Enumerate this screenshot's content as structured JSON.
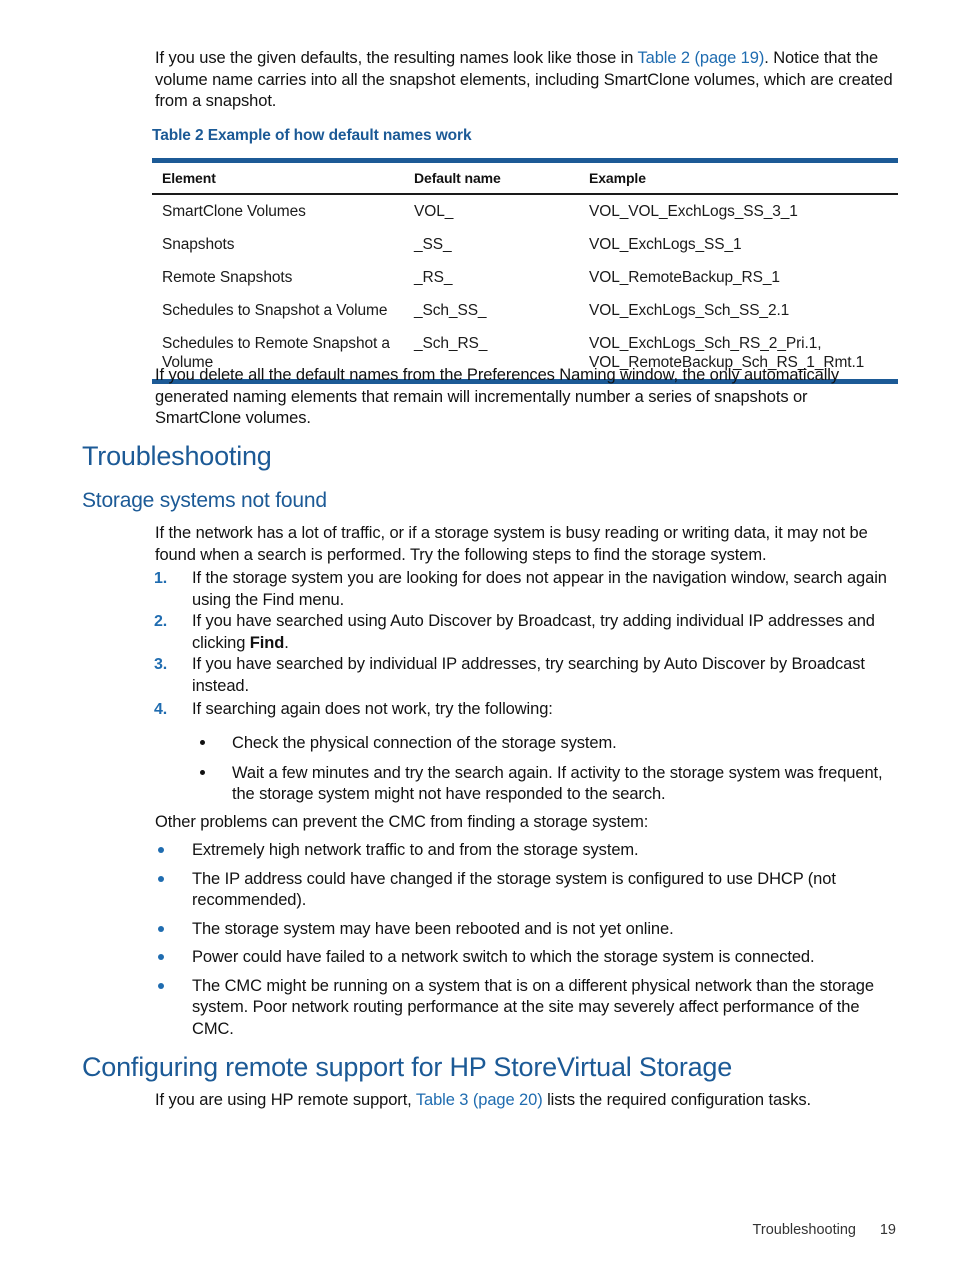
{
  "intro": {
    "text_before_link": "If you use the given defaults, the resulting names look like those in ",
    "link": "Table 2 (page 19)",
    "text_after_link": ". Notice that the volume name carries into all the snapshot elements, including SmartClone volumes, which are created from a snapshot."
  },
  "table": {
    "caption": "Table 2 Example of how default names work",
    "headers": [
      "Element",
      "Default name",
      "Example"
    ],
    "rows": [
      {
        "element": "SmartClone Volumes",
        "default_name": "VOL_",
        "example": "VOL_VOL_ExchLogs_SS_3_1"
      },
      {
        "element": "Snapshots",
        "default_name": "_SS_",
        "example": "VOL_ExchLogs_SS_1"
      },
      {
        "element": "Remote Snapshots",
        "default_name": "_RS_",
        "example": "VOL_RemoteBackup_RS_1"
      },
      {
        "element": "Schedules to Snapshot a Volume",
        "default_name": "_Sch_SS_",
        "example": "VOL_ExchLogs_Sch_SS_2.1"
      },
      {
        "element": "Schedules to Remote Snapshot a Volume",
        "default_name": "_Sch_RS_",
        "example": "VOL_ExchLogs_Sch_RS_2_Pri.1,\nVOL_RemoteBackup_Sch_RS_1_Rmt.1"
      }
    ]
  },
  "after_table_para": "If you delete all the default names from the Preferences Naming window, the only automatically generated naming elements that remain will incrementally number a series of snapshots or SmartClone volumes.",
  "headings": {
    "troubleshooting": "Troubleshooting",
    "storage_systems_not_found": "Storage systems not found",
    "configuring_remote_support": "Configuring remote support for HP StoreVirtual Storage"
  },
  "storage_intro": "If the network has a lot of traffic, or if a storage system is busy reading or writing data, it may not be found when a search is performed. Try the following steps to find the storage system.",
  "steps": [
    {
      "number": "1.",
      "text": "If the storage system you are looking for does not appear in the navigation window, search again using the Find menu."
    },
    {
      "number": "2.",
      "text_before_bold": "If you have searched using Auto Discover by Broadcast, try adding individual IP addresses and clicking ",
      "bold": "Find",
      "text_after_bold": "."
    },
    {
      "number": "3.",
      "text": "If you have searched by individual IP addresses, try searching by Auto Discover by Broadcast instead."
    },
    {
      "number": "4.",
      "text": "If searching again does not work, try the following:"
    }
  ],
  "sub_bullets": [
    "Check the physical connection of the storage system.",
    "Wait a few minutes and try the search again. If activity to the storage system was frequent, the storage system might not have responded to the search."
  ],
  "other_problems_intro": "Other problems can prevent the CMC from finding a storage system:",
  "other_problems": [
    "Extremely high network traffic to and from the storage system.",
    "The IP address could have changed if the storage system is configured to use DHCP (not recommended).",
    "The storage system may have been rebooted and is not yet online.",
    "Power could have failed to a network switch to which the storage system is connected.",
    "The CMC might be running on a system that is on a different physical network than the storage system. Poor network routing performance at the site may severely affect performance of the CMC."
  ],
  "remote_support_para": {
    "text_before_link": "If you are using HP remote support, ",
    "link": "Table 3 (page 20)",
    "text_after_link": " lists the required configuration tasks."
  },
  "footer": {
    "section": "Troubleshooting",
    "page": "19"
  },
  "colors": {
    "heading_blue": "#1C5A96",
    "link_blue": "#1F6CB0",
    "rule_blue": "#1C5A96",
    "body_black": "#121212"
  }
}
